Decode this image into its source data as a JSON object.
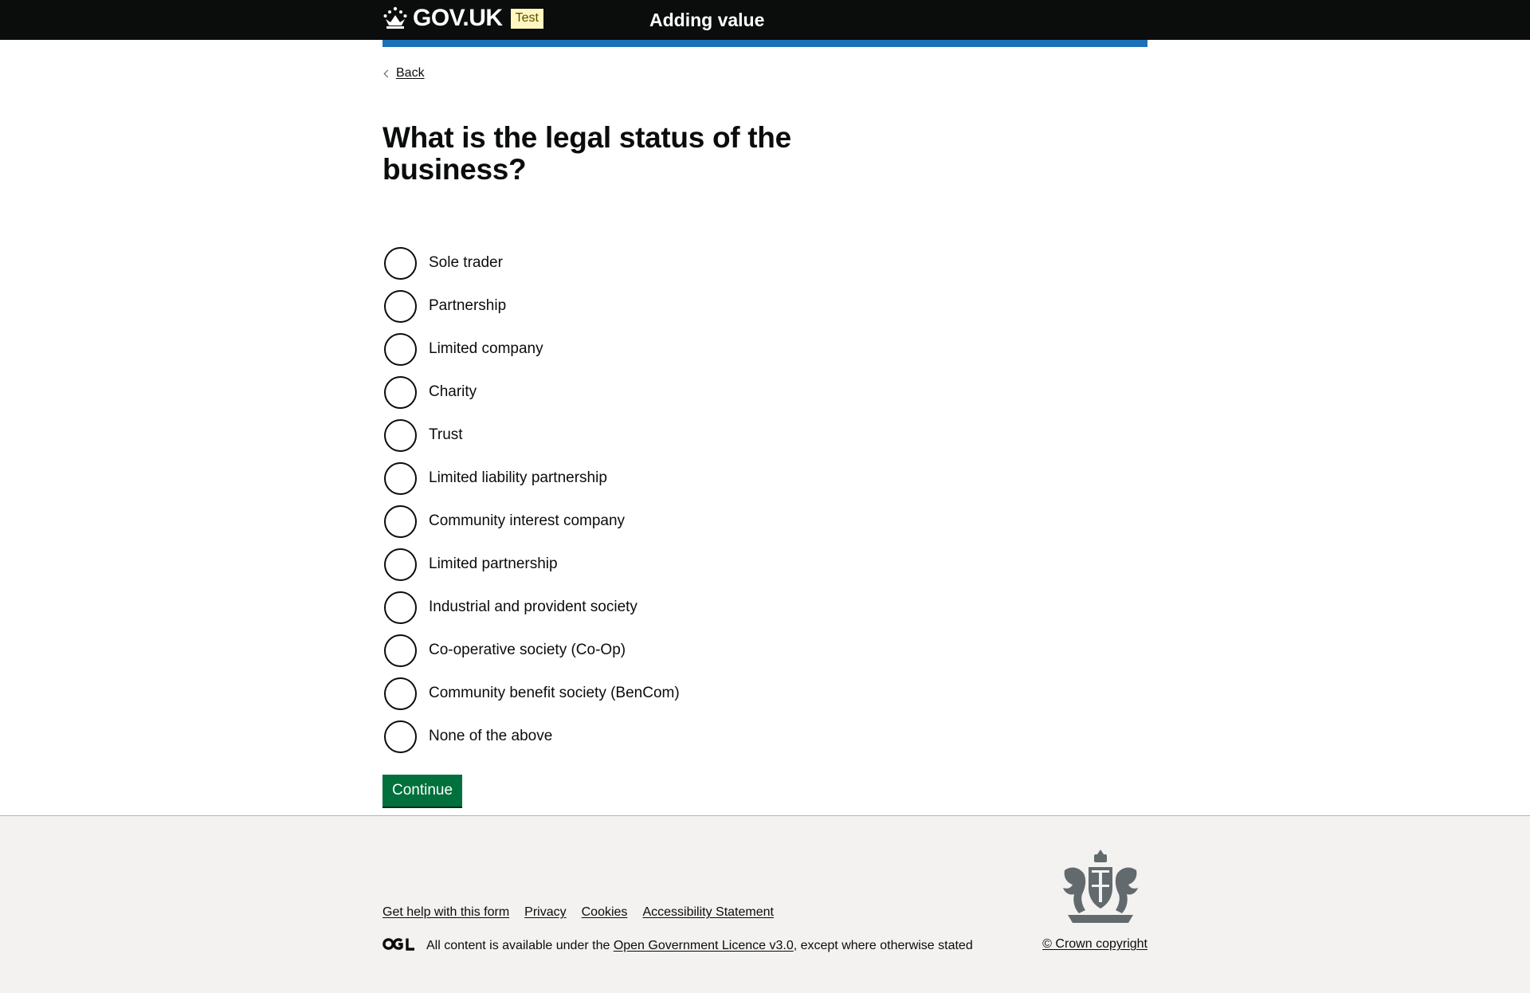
{
  "header": {
    "logo_text": "GOV.UK",
    "phase_tag": "Test",
    "service_name": "Adding value"
  },
  "nav": {
    "back_label": "Back"
  },
  "form": {
    "question": "What is the legal status of the business?",
    "options": [
      "Sole trader",
      "Partnership",
      "Limited company",
      "Charity",
      "Trust",
      "Limited liability partnership",
      "Community interest company",
      "Limited partnership",
      "Industrial and provident society",
      "Co-operative society (Co-Op)",
      "Community benefit society (BenCom)",
      "None of the above"
    ],
    "continue_label": "Continue"
  },
  "footer": {
    "links": [
      "Get help with this form",
      "Privacy",
      "Cookies",
      "Accessibility Statement"
    ],
    "licence_prefix": "All content is available under the ",
    "licence_link": "Open Government Licence v3.0",
    "licence_suffix": ", except where otherwise stated",
    "copyright": "© Crown copyright"
  },
  "colors": {
    "header_bg": "#0b0c0c",
    "accent_blue": "#1d70b8",
    "button_green": "#00703c",
    "tag_bg": "#fff7bf",
    "footer_bg": "#f3f2f1"
  }
}
